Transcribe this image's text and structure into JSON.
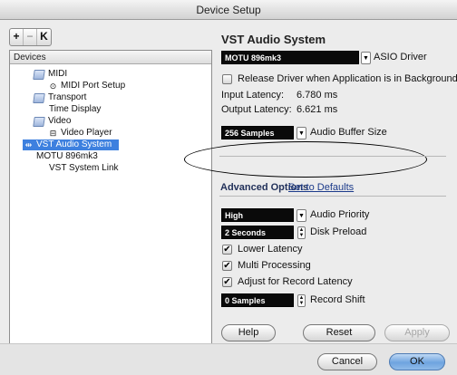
{
  "window": {
    "title": "Device Setup"
  },
  "toolbar": {
    "add": "+",
    "remove": "−",
    "reset": "K"
  },
  "devices": {
    "header": "Devices",
    "items": [
      {
        "label": "MIDI",
        "icon": "folder-icon"
      },
      {
        "label": "MIDI Port Setup",
        "icon": "midi-port-icon"
      },
      {
        "label": "Transport",
        "icon": "folder-icon"
      },
      {
        "label": "Time Display",
        "icon": ""
      },
      {
        "label": "Video",
        "icon": "folder-icon"
      },
      {
        "label": "Video Player",
        "icon": "video-player-icon"
      },
      {
        "label": "VST Audio System",
        "icon": "vst-audio-icon",
        "selected": true
      },
      {
        "label": "MOTU 896mk3",
        "icon": ""
      },
      {
        "label": "VST System Link",
        "icon": ""
      }
    ]
  },
  "vst": {
    "title": "VST Audio System",
    "driver_value": "MOTU 896mk3",
    "driver_label": "ASIO Driver",
    "release_label": "Release Driver when Application is in Background",
    "input_latency_label": "Input Latency:",
    "input_latency_value": "6.780 ms",
    "output_latency_label": "Output Latency:",
    "output_latency_value": "6.621 ms",
    "buffer_value": "256 Samples",
    "buffer_label": "Audio Buffer Size"
  },
  "advanced": {
    "title": "Advanced Options",
    "defaults_link": "Set to Defaults",
    "priority_value": "High",
    "priority_label": "Audio Priority",
    "preload_value": "2 Seconds",
    "preload_label": "Disk Preload",
    "lower_latency_label": "Lower Latency",
    "multi_processing_label": "Multi Processing",
    "adjust_record_label": "Adjust for Record Latency",
    "record_shift_value": "0 Samples",
    "record_shift_label": "Record Shift"
  },
  "buttons": {
    "help": "Help",
    "reset": "Reset",
    "apply": "Apply",
    "cancel": "Cancel",
    "ok": "OK"
  }
}
